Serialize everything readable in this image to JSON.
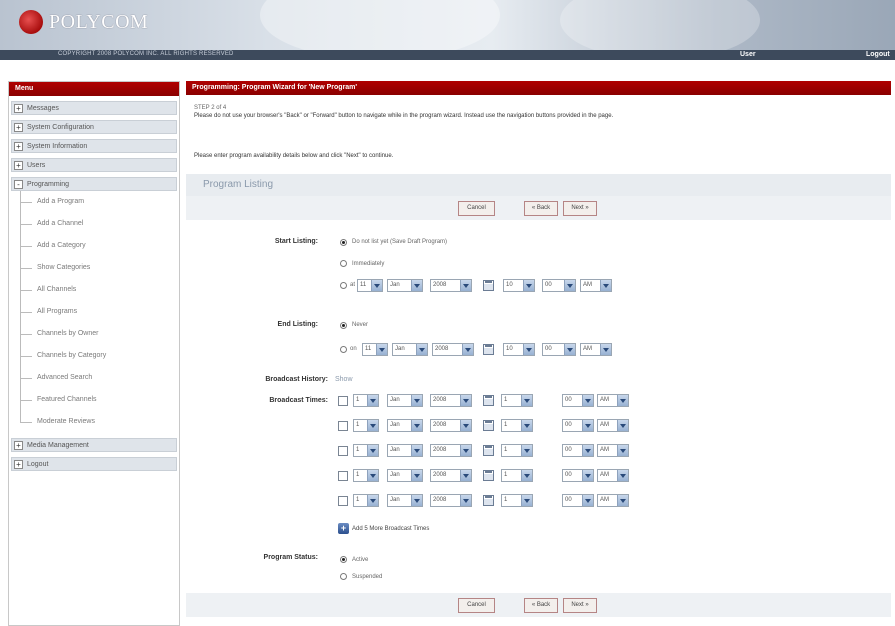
{
  "header": {
    "brand": "POLYCOM",
    "copyright": "COPYRIGHT 2008 POLYCOM INC. ALL RIGHTS RESERVED",
    "user_link": "User",
    "logout_link": "Logout",
    "accent_color": "#a80d0d"
  },
  "sidebar": {
    "title": "Menu",
    "groups_before": [
      {
        "label": "Messages",
        "state": "+"
      },
      {
        "label": "System Configuration",
        "state": "+"
      },
      {
        "label": "System Information",
        "state": "+"
      },
      {
        "label": "Users",
        "state": "+"
      }
    ],
    "programming": {
      "label": "Programming",
      "state": "-"
    },
    "sub_items": [
      "Add a Program",
      "Add a Channel",
      "Add a Category",
      "Show Categories",
      "All Channels",
      "All Programs",
      "Channels by Owner",
      "Channels by Category",
      "Advanced Search",
      "Featured Channels",
      "Moderate Reviews"
    ],
    "groups_after": [
      {
        "label": "Media Management",
        "state": "+"
      },
      {
        "label": "Logout",
        "state": "+"
      }
    ]
  },
  "main": {
    "title": "Programming: Program Wizard for 'New Program'",
    "step": "STEP 2 of 4",
    "warning": "Please do not use your browser's \"Back\" or \"Forward\" button to navigate while in the program wizard. Instead use the navigation buttons provided in the page.",
    "instruction": "Please enter program availability details below and click \"Next\" to continue.",
    "section_title": "Program Listing",
    "buttons": {
      "cancel": "Cancel",
      "back": "« Back",
      "next": "Next »"
    },
    "start_listing": {
      "label": "Start Listing:",
      "options": [
        "Do not list yet (Save Draft Program)",
        "Immediately",
        "at"
      ],
      "selected": 0,
      "date": {
        "day": "11",
        "month": "Jan",
        "year": "2008",
        "hour": "10",
        "minute": "00",
        "ampm": "AM"
      }
    },
    "end_listing": {
      "label": "End Listing:",
      "options": [
        "Never",
        "on"
      ],
      "selected": 0,
      "date": {
        "day": "11",
        "month": "Jan",
        "year": "2008",
        "hour": "10",
        "minute": "00",
        "ampm": "AM"
      }
    },
    "broadcast_history": {
      "label": "Broadcast History:",
      "link": "Show"
    },
    "broadcast_times": {
      "label": "Broadcast Times:",
      "rows": [
        {
          "day": "1",
          "month": "Jan",
          "year": "2008",
          "hour": "1",
          "minute": "00",
          "ampm": "AM"
        },
        {
          "day": "1",
          "month": "Jan",
          "year": "2008",
          "hour": "1",
          "minute": "00",
          "ampm": "AM"
        },
        {
          "day": "1",
          "month": "Jan",
          "year": "2008",
          "hour": "1",
          "minute": "00",
          "ampm": "AM"
        },
        {
          "day": "1",
          "month": "Jan",
          "year": "2008",
          "hour": "1",
          "minute": "00",
          "ampm": "AM"
        },
        {
          "day": "1",
          "month": "Jan",
          "year": "2008",
          "hour": "1",
          "minute": "00",
          "ampm": "AM"
        }
      ],
      "add_more": "Add 5 More Broadcast Times"
    },
    "program_status": {
      "label": "Program Status:",
      "options": [
        "Active",
        "Suspended"
      ],
      "selected": 0
    }
  }
}
